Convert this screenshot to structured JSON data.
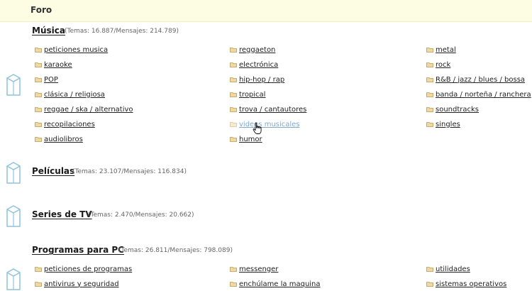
{
  "header": {
    "title": "Foro"
  },
  "categories": [
    {
      "title": "Música",
      "stats": "(Temas: 16.887/Mensajes: 214.789)",
      "subforums": [
        "peticiones musica",
        "reggaeton",
        "metal",
        "karaoke",
        "electrónica",
        "rock",
        "POP",
        "hip-hop / rap",
        "R&B / jazz / blues / bossa",
        "clásica / religiosa",
        "tropical",
        "banda / norteña / ranchera",
        "reggae / ska / alternativo",
        "trova / cantautores",
        "soundtracks",
        "recopilaciones",
        "videos musicales",
        "singles",
        "audiolibros",
        "humor"
      ]
    },
    {
      "title": "Películas",
      "stats": "(Temas: 23.107/Mensajes: 116.834)"
    },
    {
      "title": "Series de TV",
      "stats": "(Temas: 2.470/Mensajes: 20.662)"
    },
    {
      "title": "Programas para PC",
      "stats": "(Temas: 26.811/Mensajes: 798.089)",
      "subforums": [
        "peticiones de programas",
        "messenger",
        "utilidades",
        "antivirus y seguridad",
        "enchúlame la maquina",
        "sistemas operativos"
      ]
    }
  ],
  "colors": {
    "header_bg": "#fdfde3",
    "link_hover": "#7fa9cf",
    "icon_stroke": "#8fc4dc",
    "folder_fill": "#f0d9a0"
  },
  "icons": {
    "category": "forum-box-icon",
    "subforum": "folder-icon",
    "pointer": "hand-cursor-icon"
  }
}
